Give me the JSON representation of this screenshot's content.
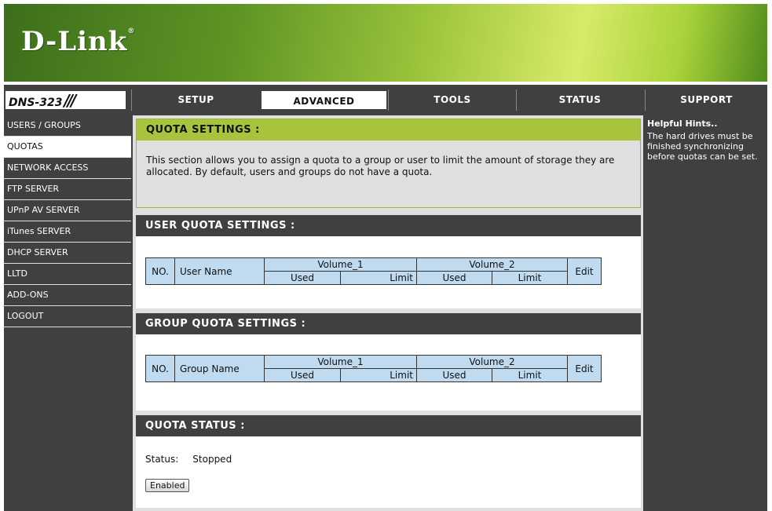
{
  "brand": {
    "logo": "D-Link",
    "mark": "®",
    "model": "DNS-323",
    "slashes": "///"
  },
  "nav": {
    "tabs": [
      {
        "label": "SETUP"
      },
      {
        "label": "ADVANCED"
      },
      {
        "label": "TOOLS"
      },
      {
        "label": "STATUS"
      },
      {
        "label": "SUPPORT"
      }
    ],
    "active": "ADVANCED"
  },
  "sidebar": {
    "items": [
      {
        "label": "USERS / GROUPS"
      },
      {
        "label": "QUOTAS"
      },
      {
        "label": "NETWORK ACCESS"
      },
      {
        "label": "FTP SERVER"
      },
      {
        "label": "UPnP AV SERVER"
      },
      {
        "label": "iTunes SERVER"
      },
      {
        "label": "DHCP SERVER"
      },
      {
        "label": "LLTD"
      },
      {
        "label": "ADD-ONS"
      },
      {
        "label": "LOGOUT"
      }
    ],
    "active": "QUOTAS"
  },
  "quota_settings": {
    "title": "QUOTA SETTINGS :",
    "description": "This section allows you to assign a quota to a group or user to limit the amount of storage they are allocated. By default, users and groups do not have a quota."
  },
  "user_quota": {
    "title": "USER QUOTA SETTINGS :",
    "columns": {
      "no": "NO.",
      "name": "User Name",
      "volume1": "Volume_1",
      "volume2": "Volume_2",
      "used": "Used",
      "limit": "Limit",
      "edit": "Edit"
    }
  },
  "group_quota": {
    "title": "GROUP QUOTA SETTINGS :",
    "columns": {
      "no": "NO.",
      "name": "Group Name",
      "volume1": "Volume_1",
      "volume2": "Volume_2",
      "used": "Used",
      "limit": "Limit",
      "edit": "Edit"
    }
  },
  "quota_status": {
    "title": "QUOTA STATUS :",
    "status_label": "Status:",
    "status_value": "Stopped",
    "button_label": "Enabled"
  },
  "hints": {
    "title": "Helpful Hints..",
    "text": "The hard drives must be finished synchronizing before quotas can be set."
  },
  "colors": {
    "banner_green": "#5e9424",
    "header_green": "#a8c43d",
    "dark": "#404040",
    "table_blue": "#c0dbf0"
  }
}
